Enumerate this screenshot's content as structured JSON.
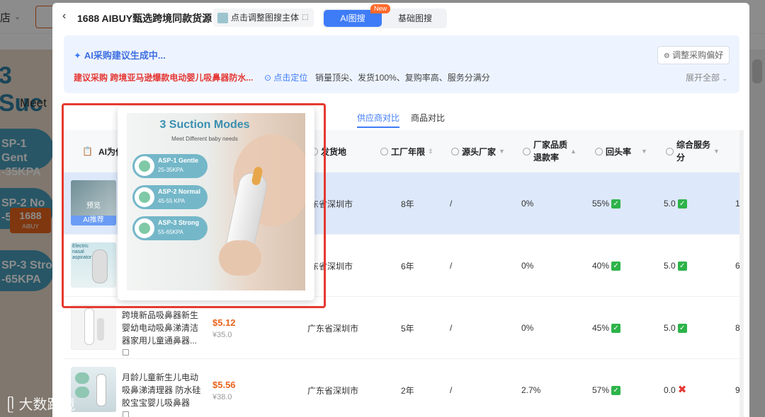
{
  "background": {
    "shop_label": "店",
    "hero_title": "3 Suc",
    "hero_sub": "Meet",
    "pill1": "SP-1 Gent\n-35KPA",
    "pill2": "SP-2 No",
    "pill2b": "-5",
    "pill3": "SP-3 Stro\n-65KPA",
    "logo_num": "1688",
    "logo_sub": "AiBUY"
  },
  "header": {
    "back_icon": "chevron-left-icon",
    "title": "1688 AIBUY甄选跨境同款货源",
    "adjust_subject": "点击调整图搜主体",
    "seg_ai": "AI图搜",
    "seg_ai_badge": "New",
    "seg_basic": "基础图搜"
  },
  "ai_panel": {
    "generating": "AI采购建议生成中...",
    "pref_button": "调整采购偏好",
    "suggest": "建议采购 跨境亚马逊爆款电动婴儿吸鼻器防水...",
    "locate": "点击定位",
    "desc": "销量顶尖、发货100%、复购率高、服务分满分",
    "expand": "展开全部"
  },
  "tabs": {
    "supplier": "供应商对比",
    "product": "商品对比"
  },
  "table": {
    "headers": {
      "ai": "AI为你",
      "ship": "发货地",
      "years": "工厂年限",
      "source": "源头厂家",
      "refund_line1": "厂家品质",
      "refund_line2": "退款率",
      "repurchase": "回头率",
      "service_line1": "综合服务",
      "service_line2": "分"
    },
    "rows": [
      {
        "ai_tag": "AI推荐",
        "preview": "预览",
        "name": "",
        "price": "",
        "orig": "",
        "ship": "东省深圳市",
        "years": "8年",
        "source": "/",
        "refund": "0%",
        "repurchase": "55%",
        "rep_ok": "✓",
        "service": "5.0",
        "svc_ok": "✓",
        "extra": "1"
      },
      {
        "ai_tag": "",
        "name": "",
        "price": "",
        "orig": "",
        "ship": "东省深圳市",
        "years": "6年",
        "source": "/",
        "refund": "0%",
        "repurchase": "40%",
        "rep_ok": "✓",
        "service": "5.0",
        "svc_ok": "✓",
        "extra": "6"
      },
      {
        "ai_tag": "",
        "name": "跨境新品吸鼻器新生婴幼电动吸鼻涕清洁器家用儿童通鼻器...",
        "price": "$5.12",
        "orig": "¥35.0",
        "ship": "广东省深圳市",
        "years": "5年",
        "source": "/",
        "refund": "0%",
        "repurchase": "45%",
        "rep_ok": "✓",
        "service": "5.0",
        "svc_ok": "✓",
        "extra": "8"
      },
      {
        "ai_tag": "",
        "name": "月龄儿童新生儿电动吸鼻涕清理器 防水硅胶宝宝婴儿吸鼻器",
        "price": "$5.56",
        "orig": "¥38.0",
        "ship": "广东省深圳市",
        "years": "2年",
        "source": "/",
        "refund": "2.7%",
        "repurchase": "57%",
        "rep_ok": "✓",
        "service": "0.0",
        "svc_bad": "✖",
        "extra": "9"
      }
    ]
  },
  "popup": {
    "title": "3 Suction Modes",
    "subtitle": "Meet Different baby needs",
    "modes": [
      {
        "name": "ASP-1 Gentle",
        "range": "25-35KPA"
      },
      {
        "name": "ASP-2 Normal",
        "range": "45-55 KPA"
      },
      {
        "name": "ASP-3 Strong",
        "range": "55-65KPA"
      }
    ]
  },
  "thumb2_text": "Electric nasal aspirator",
  "watermark": "大数跨境",
  "colors": {
    "accent": "#3e7cf7",
    "price": "#e8641d",
    "highlight": "#e53930",
    "ok": "#2db34a"
  }
}
